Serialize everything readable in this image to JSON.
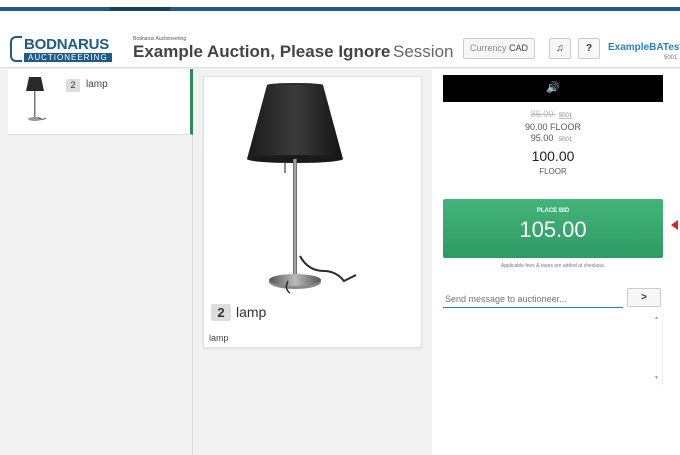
{
  "header": {
    "logo_name": "BODNARUS",
    "logo_sub": "AUCTIONEERING",
    "company": "Bodnarus Auctioneering",
    "auction_title": "Example Auction, Please Ignore",
    "session_label": "Session",
    "currency_label": "Currency",
    "currency_value": "CAD",
    "sound_icon": "♫",
    "help_label": "?",
    "user_name": "ExampleBATest",
    "user_number": "5001"
  },
  "sidebar": {
    "lots": [
      {
        "number": "2",
        "name": "lamp"
      }
    ]
  },
  "lot": {
    "number": "2",
    "title": "lamp",
    "description": "lamp"
  },
  "bidding": {
    "speaker_icon": "🔊",
    "history": [
      {
        "amount": "85.00",
        "bidder": "5001",
        "struck": true
      },
      {
        "amount": "90.00",
        "bidder": "FLOOR",
        "struck": false
      },
      {
        "amount": "95.00",
        "bidder": "5001",
        "struck": false
      }
    ],
    "current_amount": "100.00",
    "current_bidder": "FLOOR",
    "place_bid_label": "PLACE BID",
    "place_bid_amount": "105.00",
    "fees_note": "Applicable fees & taxes are added at checkout."
  },
  "chat": {
    "placeholder": "Send message to auctioneer...",
    "send_label": ">"
  },
  "colors": {
    "accent_blue": "#1f5b86",
    "link_blue": "#2a7fc1",
    "bid_green": "#2f9a63",
    "active_border": "#2e8b57",
    "marker_red": "#d9242b"
  }
}
